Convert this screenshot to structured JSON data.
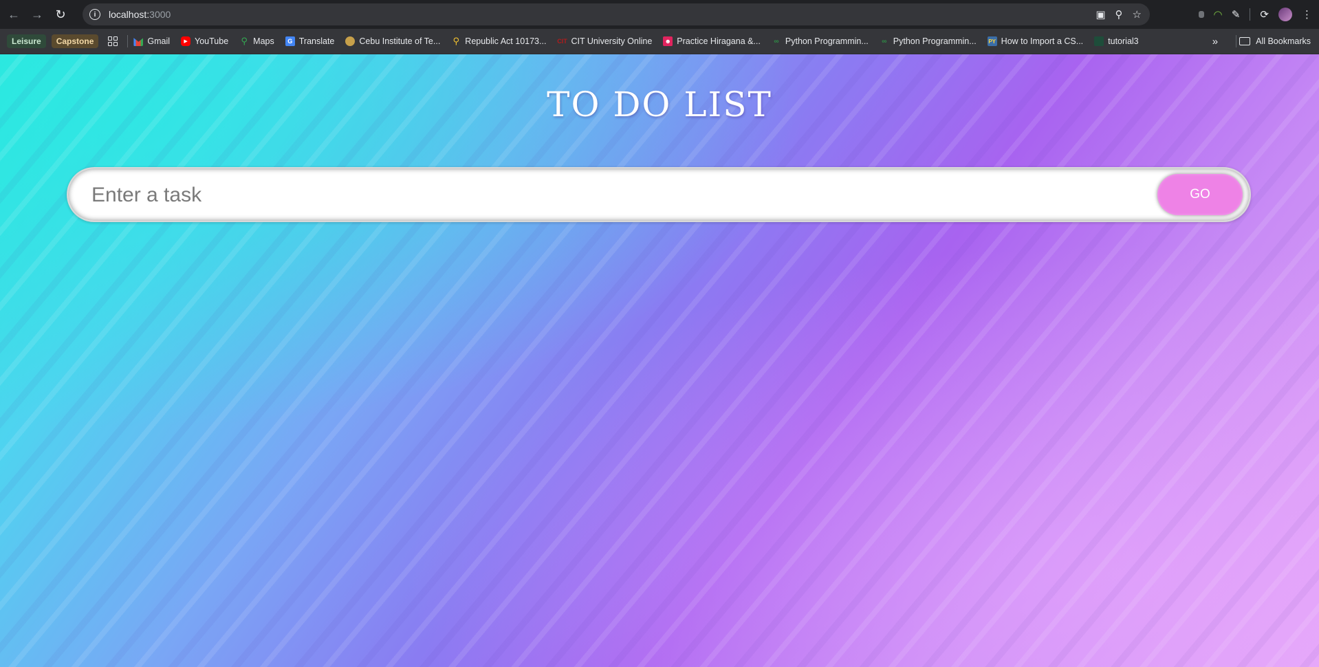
{
  "browser": {
    "url_host": "localhost:",
    "url_port": "3000",
    "bookmarks": [
      {
        "label": "Gmail",
        "icon": "gmail-icon"
      },
      {
        "label": "YouTube",
        "icon": "youtube-icon"
      },
      {
        "label": "Maps",
        "icon": "maps-icon"
      },
      {
        "label": "Translate",
        "icon": "translate-icon"
      },
      {
        "label": "Cebu Institute of Te...",
        "icon": "cebu-icon"
      },
      {
        "label": "Republic Act 10173...",
        "icon": "republic-act-icon"
      },
      {
        "label": "CIT University Online",
        "icon": "cit-icon"
      },
      {
        "label": "Practice Hiragana &...",
        "icon": "hiragana-icon"
      },
      {
        "label": "Python Programmin...",
        "icon": "gfg-icon"
      },
      {
        "label": "Python Programmin...",
        "icon": "gfg-icon"
      },
      {
        "label": "How to Import a CS...",
        "icon": "python-icon"
      },
      {
        "label": "tutorial3",
        "icon": "tutorial-icon"
      }
    ],
    "groups": [
      "Leisure",
      "Capstone"
    ],
    "all_bookmarks_label": "All Bookmarks"
  },
  "app": {
    "title": "TO DO LIST",
    "input_placeholder": "Enter a task",
    "go_label": "GO"
  }
}
